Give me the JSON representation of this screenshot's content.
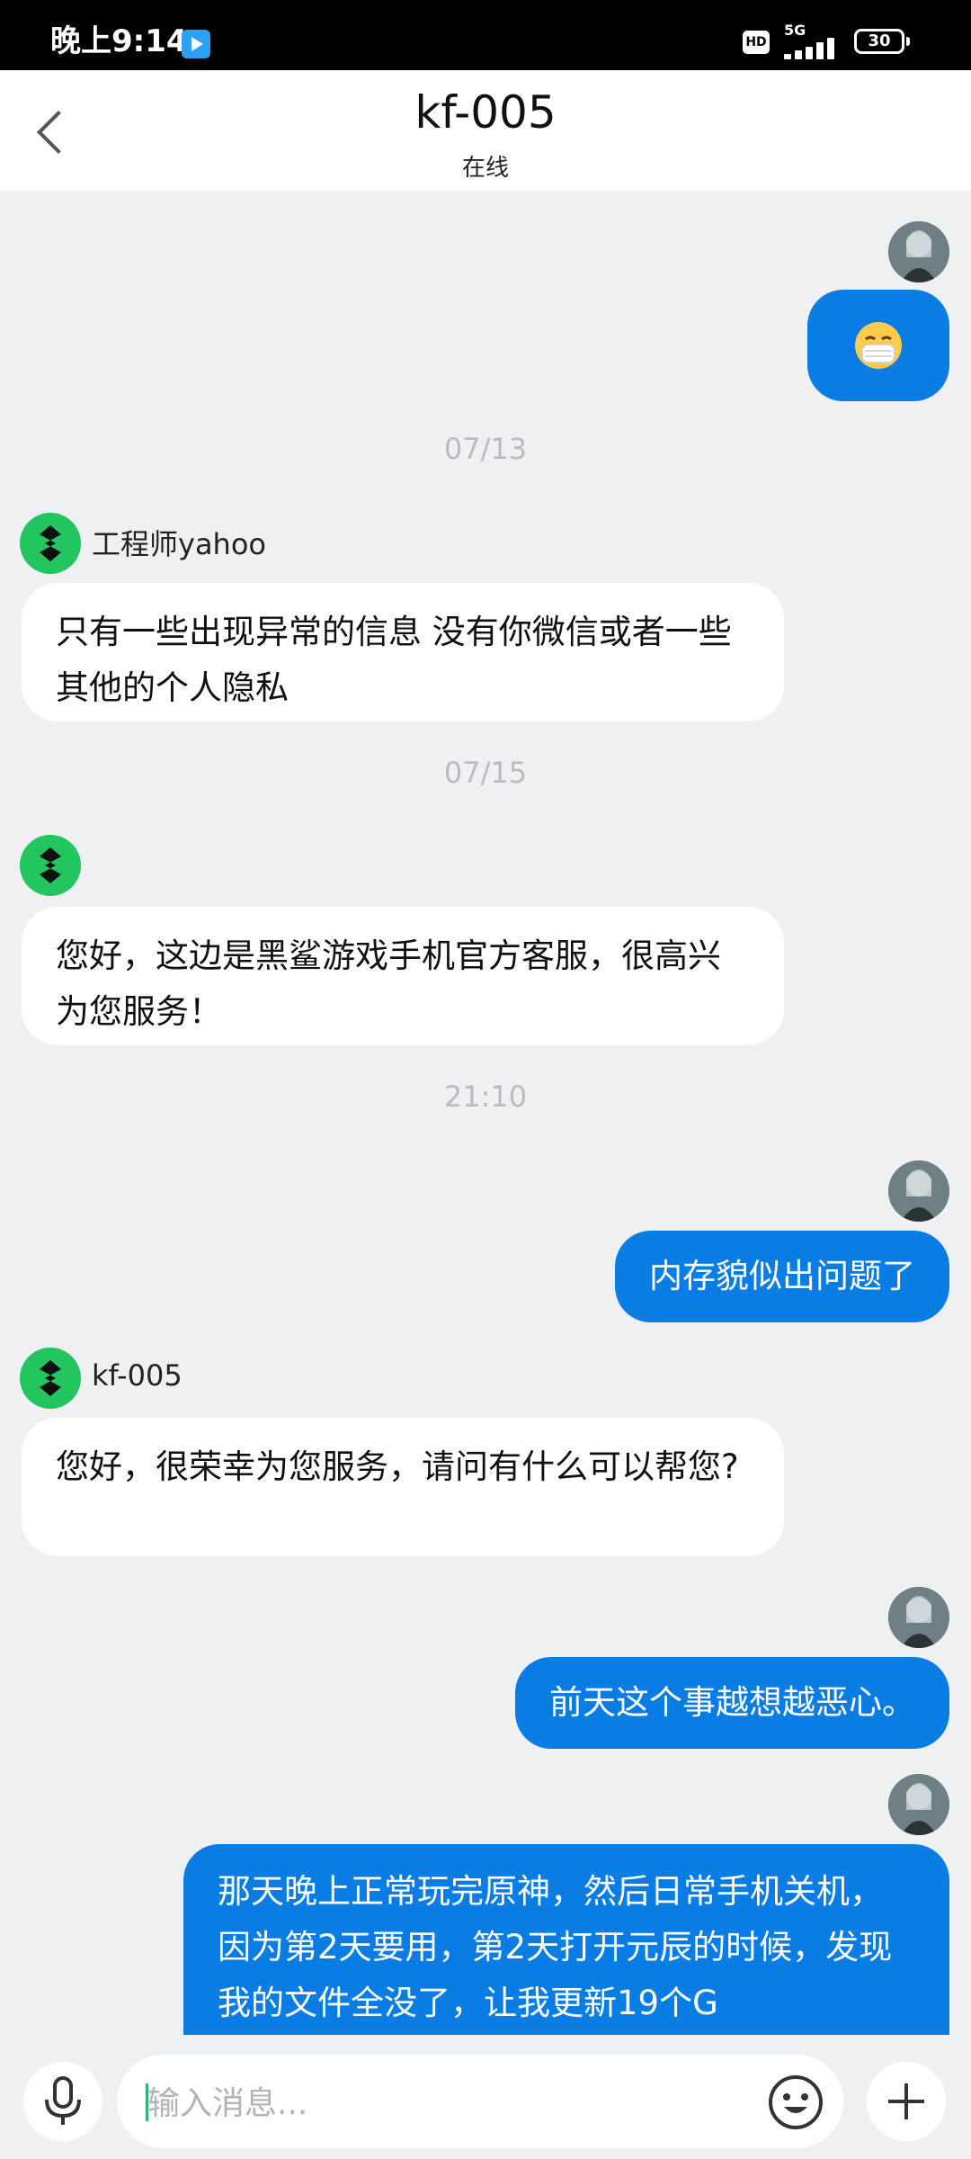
{
  "status_bar": {
    "time": "晚上9:14",
    "network": "5G",
    "hd": "HD",
    "battery": "30"
  },
  "header": {
    "title": "kf-005",
    "status": "在线"
  },
  "messages": {
    "ts1": "07/13",
    "agent_name_1": "工程师yahoo",
    "in1": "只有一些出现异常的信息 没有你微信或者一些其他的个人隐私",
    "ts2": "07/15",
    "in2": "您好，这边是黑鲨游戏手机官方客服，很高兴为您服务！",
    "ts3": "21:10",
    "out1": "内存貌似出问题了",
    "agent_name_2": "kf-005",
    "in3": "您好，很荣幸为您服务，请问有什么可以帮您?",
    "out2": "前天这个事越想越恶心。",
    "out3": "那天晚上正常玩完原神，然后日常手机关机，因为第2天要用，第2天打开元辰的时候，发现我的文件全没了，让我更新19个G"
  },
  "input": {
    "placeholder": "输入消息..."
  },
  "colors": {
    "accent": "#0a7de5",
    "agent_avatar": "#23c55e",
    "background": "#eff0f1"
  },
  "icons": [
    "back-icon",
    "mic-icon",
    "emoji-icon",
    "plus-icon",
    "mask-emoji-icon",
    "blackshark-logo-icon"
  ]
}
